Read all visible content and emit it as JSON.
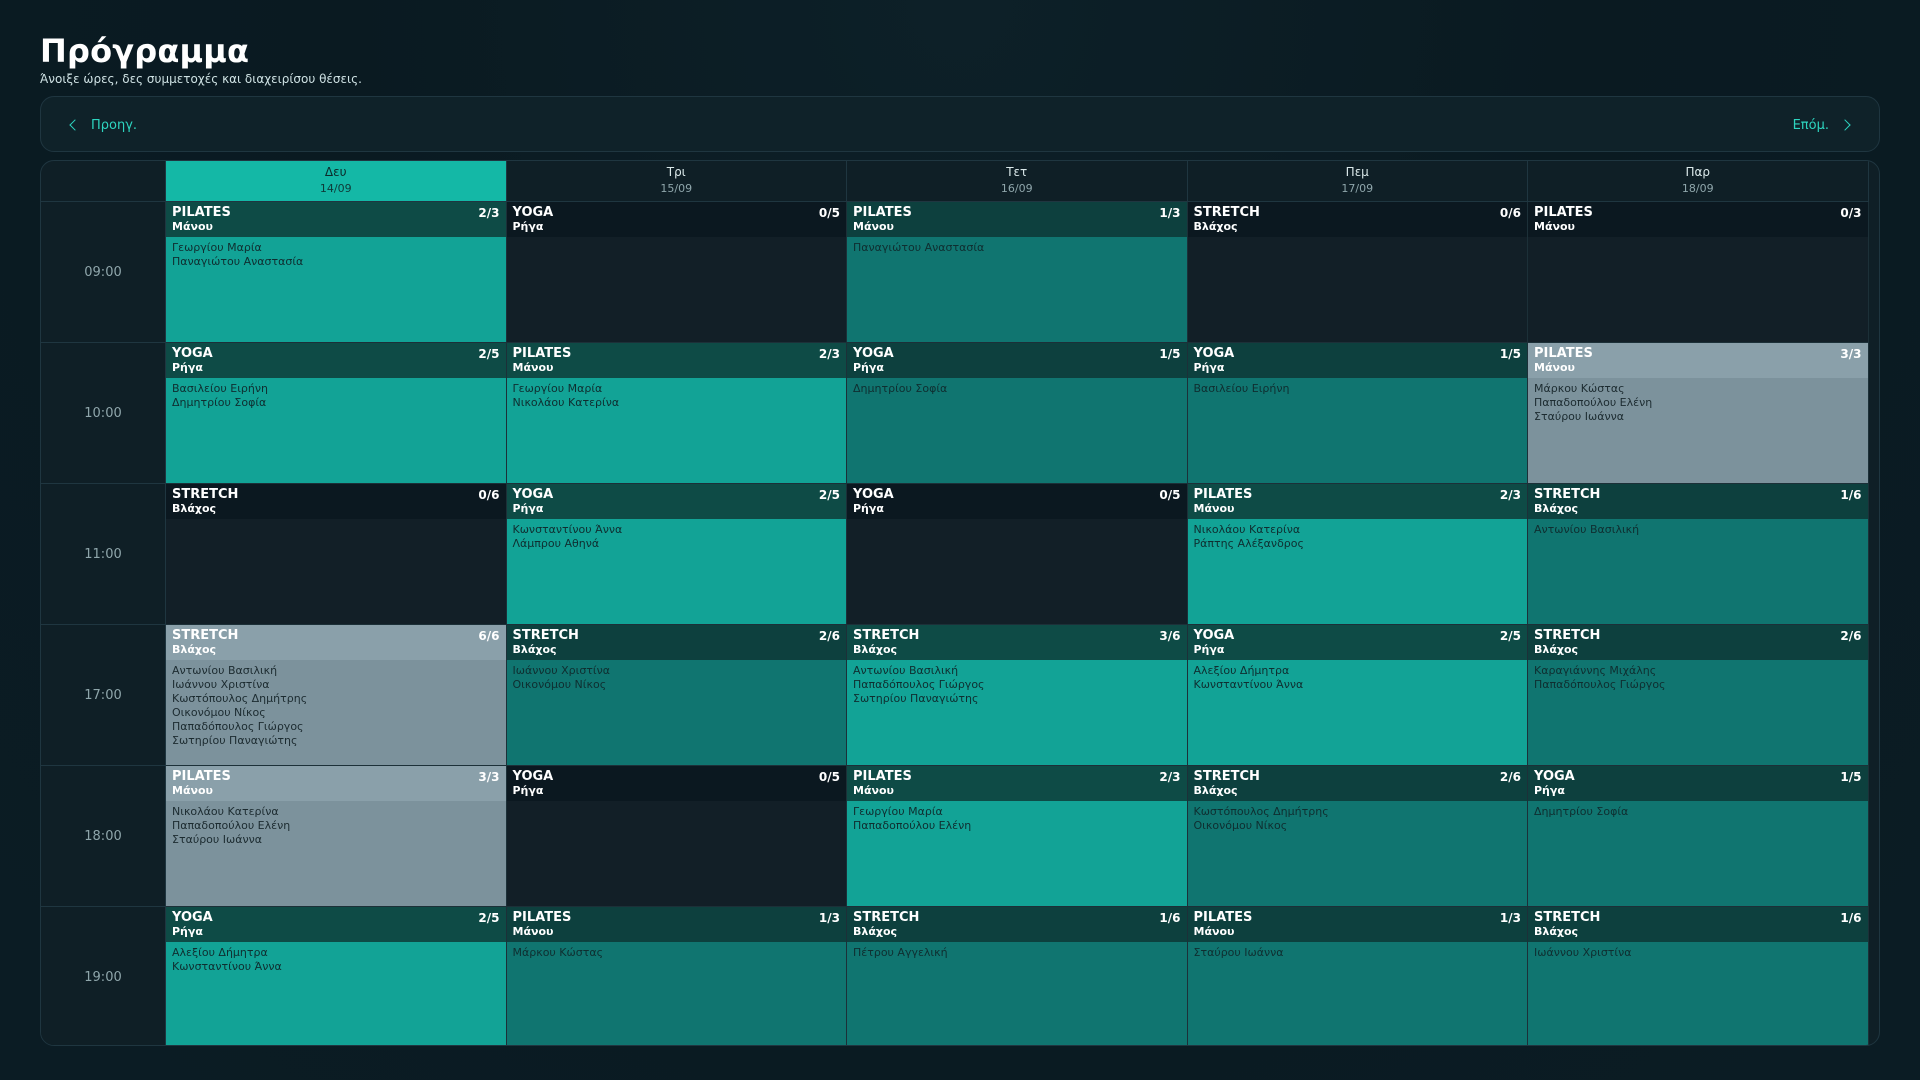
{
  "header": {
    "title": "Πρόγραμμα",
    "subtitle": "Άνοιξε ώρες, δες συμμετοχές και διαχειρίσου θέσεις."
  },
  "nav": {
    "prev_label": "Προηγ.",
    "next_label": "Επόμ."
  },
  "days": [
    {
      "name": "Δευ",
      "date": "14/09",
      "active": true
    },
    {
      "name": "Τρι",
      "date": "15/09",
      "active": false
    },
    {
      "name": "Τετ",
      "date": "16/09",
      "active": false
    },
    {
      "name": "Πεμ",
      "date": "17/09",
      "active": false
    },
    {
      "name": "Παρ",
      "date": "18/09",
      "active": false
    }
  ],
  "times": [
    "09:00",
    "10:00",
    "11:00",
    "17:00",
    "18:00",
    "19:00"
  ],
  "colors": {
    "accent": "#14b8a6",
    "empty": "#121f27",
    "low": "#107570",
    "mid": "#12a396",
    "full": "#7c929c"
  },
  "slots": [
    [
      {
        "class": "PILATES",
        "coach": "Μάνου",
        "count": "2/3",
        "occupancy": 0.67,
        "people": [
          "Γεωργίου Μαρία",
          "Παναγιώτου Αναστασία"
        ]
      },
      {
        "class": "YOGA",
        "coach": "Ρήγα",
        "count": "0/5",
        "occupancy": 0,
        "people": []
      },
      {
        "class": "PILATES",
        "coach": "Μάνου",
        "count": "1/3",
        "occupancy": 0.33,
        "people": [
          "Παναγιώτου Αναστασία"
        ]
      },
      {
        "class": "STRETCH",
        "coach": "Βλάχος",
        "count": "0/6",
        "occupancy": 0,
        "people": []
      },
      {
        "class": "PILATES",
        "coach": "Μάνου",
        "count": "0/3",
        "occupancy": 0,
        "people": []
      }
    ],
    [
      {
        "class": "YOGA",
        "coach": "Ρήγα",
        "count": "2/5",
        "occupancy": 0.4,
        "people": [
          "Βασιλείου Ειρήνη",
          "Δημητρίου Σοφία"
        ]
      },
      {
        "class": "PILATES",
        "coach": "Μάνου",
        "count": "2/3",
        "occupancy": 0.67,
        "people": [
          "Γεωργίου Μαρία",
          "Νικολάου Κατερίνα"
        ]
      },
      {
        "class": "YOGA",
        "coach": "Ρήγα",
        "count": "1/5",
        "occupancy": 0.2,
        "people": [
          "Δημητρίου Σοφία"
        ]
      },
      {
        "class": "YOGA",
        "coach": "Ρήγα",
        "count": "1/5",
        "occupancy": 0.2,
        "people": [
          "Βασιλείου Ειρήνη"
        ]
      },
      {
        "class": "PILATES",
        "coach": "Μάνου",
        "count": "3/3",
        "occupancy": 1,
        "people": [
          "Μάρκου Κώστας",
          "Παπαδοπούλου Ελένη",
          "Σταύρου Ιωάννα"
        ]
      }
    ],
    [
      {
        "class": "STRETCH",
        "coach": "Βλάχος",
        "count": "0/6",
        "occupancy": 0,
        "people": []
      },
      {
        "class": "YOGA",
        "coach": "Ρήγα",
        "count": "2/5",
        "occupancy": 0.4,
        "people": [
          "Κωνσταντίνου Άννα",
          "Λάμπρου Αθηνά"
        ]
      },
      {
        "class": "YOGA",
        "coach": "Ρήγα",
        "count": "0/5",
        "occupancy": 0,
        "people": []
      },
      {
        "class": "PILATES",
        "coach": "Μάνου",
        "count": "2/3",
        "occupancy": 0.67,
        "people": [
          "Νικολάου Κατερίνα",
          "Ράπτης Αλέξανδρος"
        ]
      },
      {
        "class": "STRETCH",
        "coach": "Βλάχος",
        "count": "1/6",
        "occupancy": 0.17,
        "people": [
          "Αντωνίου Βασιλική"
        ]
      }
    ],
    [
      {
        "class": "STRETCH",
        "coach": "Βλάχος",
        "count": "6/6",
        "occupancy": 1,
        "people": [
          "Αντωνίου Βασιλική",
          "Ιωάννου Χριστίνα",
          "Κωστόπουλος Δημήτρης",
          "Οικονόμου Νίκος",
          "Παπαδόπουλος Γιώργος",
          "Σωτηρίου Παναγιώτης"
        ]
      },
      {
        "class": "STRETCH",
        "coach": "Βλάχος",
        "count": "2/6",
        "occupancy": 0.33,
        "people": [
          "Ιωάννου Χριστίνα",
          "Οικονόμου Νίκος"
        ]
      },
      {
        "class": "STRETCH",
        "coach": "Βλάχος",
        "count": "3/6",
        "occupancy": 0.5,
        "people": [
          "Αντωνίου Βασιλική",
          "Παπαδόπουλος Γιώργος",
          "Σωτηρίου Παναγιώτης"
        ]
      },
      {
        "class": "YOGA",
        "coach": "Ρήγα",
        "count": "2/5",
        "occupancy": 0.4,
        "people": [
          "Αλεξίου Δήμητρα",
          "Κωνσταντίνου Άννα"
        ]
      },
      {
        "class": "STRETCH",
        "coach": "Βλάχος",
        "count": "2/6",
        "occupancy": 0.33,
        "people": [
          "Καραγιάννης Μιχάλης",
          "Παπαδόπουλος Γιώργος"
        ]
      }
    ],
    [
      {
        "class": "PILATES",
        "coach": "Μάνου",
        "count": "3/3",
        "occupancy": 1,
        "people": [
          "Νικολάου Κατερίνα",
          "Παπαδοπούλου Ελένη",
          "Σταύρου Ιωάννα"
        ]
      },
      {
        "class": "YOGA",
        "coach": "Ρήγα",
        "count": "0/5",
        "occupancy": 0,
        "people": []
      },
      {
        "class": "PILATES",
        "coach": "Μάνου",
        "count": "2/3",
        "occupancy": 0.67,
        "people": [
          "Γεωργίου Μαρία",
          "Παπαδοπούλου Ελένη"
        ]
      },
      {
        "class": "STRETCH",
        "coach": "Βλάχος",
        "count": "2/6",
        "occupancy": 0.33,
        "people": [
          "Κωστόπουλος Δημήτρης",
          "Οικονόμου Νίκος"
        ]
      },
      {
        "class": "YOGA",
        "coach": "Ρήγα",
        "count": "1/5",
        "occupancy": 0.2,
        "people": [
          "Δημητρίου Σοφία"
        ]
      }
    ],
    [
      {
        "class": "YOGA",
        "coach": "Ρήγα",
        "count": "2/5",
        "occupancy": 0.4,
        "people": [
          "Αλεξίου Δήμητρα",
          "Κωνσταντίνου Άννα"
        ]
      },
      {
        "class": "PILATES",
        "coach": "Μάνου",
        "count": "1/3",
        "occupancy": 0.33,
        "people": [
          "Μάρκου Κώστας"
        ]
      },
      {
        "class": "STRETCH",
        "coach": "Βλάχος",
        "count": "1/6",
        "occupancy": 0.17,
        "people": [
          "Πέτρου Αγγελική"
        ]
      },
      {
        "class": "PILATES",
        "coach": "Μάνου",
        "count": "1/3",
        "occupancy": 0.33,
        "people": [
          "Σταύρου Ιωάννα"
        ]
      },
      {
        "class": "STRETCH",
        "coach": "Βλάχος",
        "count": "1/6",
        "occupancy": 0.17,
        "people": [
          "Ιωάννου Χριστίνα"
        ]
      }
    ]
  ]
}
